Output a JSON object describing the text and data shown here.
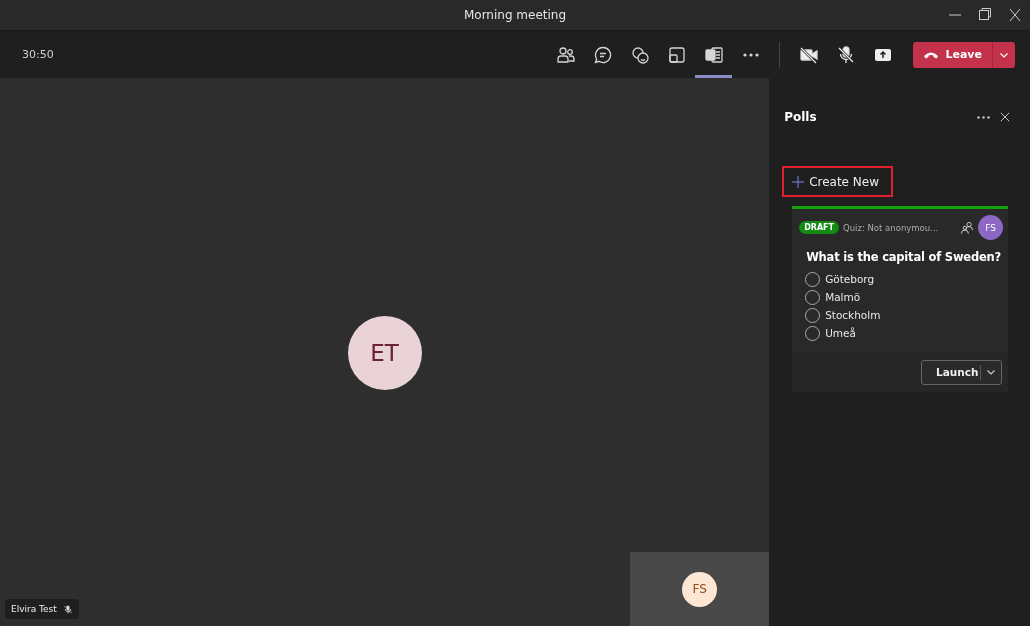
{
  "window": {
    "title": "Morning meeting"
  },
  "toolbar": {
    "timer": "30:50",
    "buttons": [
      {
        "kind": "people",
        "selected": false
      },
      {
        "kind": "chat",
        "selected": false
      },
      {
        "kind": "reactions",
        "selected": false
      },
      {
        "kind": "rooms",
        "selected": false
      },
      {
        "kind": "apps",
        "selected": true
      },
      {
        "kind": "more",
        "selected": false
      }
    ],
    "leave": "Leave"
  },
  "stage": {
    "initials": "ET",
    "name_tag": "Elvira Test",
    "self_view": {
      "initials": "FS"
    }
  },
  "panel": {
    "title": "Polls",
    "create": "Create New",
    "poll": {
      "status": "DRAFT",
      "meta": "Quiz: Not anonymou...",
      "author": "FS",
      "question": "What is the capital of Sweden?",
      "options": [
        {
          "label": "Göteborg",
          "selected": false
        },
        {
          "label": "Malmö",
          "selected": false
        },
        {
          "label": "Stockholm",
          "selected": false
        },
        {
          "label": "Umeå",
          "selected": false
        }
      ],
      "launch": "Launch"
    }
  }
}
